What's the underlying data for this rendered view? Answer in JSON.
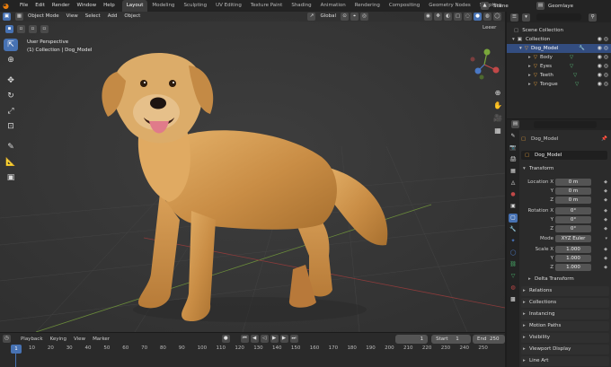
{
  "app_menu": [
    "File",
    "Edit",
    "Render",
    "Window",
    "Help"
  ],
  "workspaces": [
    "Layout",
    "Modeling",
    "Sculpting",
    "UV Editing",
    "Texture Paint",
    "Shading",
    "Animation",
    "Rendering",
    "Compositing",
    "Geometry Nodes",
    "Scripting"
  ],
  "scene_name": "Scene",
  "view_layer": "GeomIaye",
  "viewport": {
    "mode": "Object Mode",
    "menus": [
      "View",
      "Select",
      "Add",
      "Object"
    ],
    "orientation": "Global",
    "perspective_label": "User Perspective",
    "collection_label": "(1) Collection | Dog_Model",
    "right_hint": "Leeer"
  },
  "outliner": {
    "root": "Scene Collection",
    "collection": "Collection",
    "items": [
      {
        "name": "Dog_Model",
        "selected": true
      },
      {
        "name": "Body"
      },
      {
        "name": "Eyes"
      },
      {
        "name": "Teeth"
      },
      {
        "name": "Tongue"
      }
    ]
  },
  "properties": {
    "object_name": "Dog_Model",
    "object_field": "Dog_Model",
    "transform_header": "Transform",
    "location_label": "Location X",
    "location": {
      "x": "0 m",
      "y": "0 m",
      "z": "0 m"
    },
    "rotation_label": "Rotation X",
    "rotation": {
      "x": "0°",
      "y": "0°",
      "z": "0°"
    },
    "mode_label": "Mode",
    "mode_value": "XYZ Euler",
    "scale_label": "Scale X",
    "scale": {
      "x": "1.000",
      "y": "1.000",
      "z": "1.000"
    },
    "axis_y": "Y",
    "axis_z": "Z",
    "sections": [
      "Delta Transform",
      "Relations",
      "Collections",
      "Instancing",
      "Motion Paths",
      "Visibility",
      "Viewport Display",
      "Line Art"
    ]
  },
  "timeline": {
    "menus": [
      "Playback",
      "Keying",
      "View",
      "Marker"
    ],
    "current_frame": "1",
    "start_label": "Start",
    "start": "1",
    "end_label": "End",
    "end": "250",
    "ruler": [
      "1",
      "10",
      "20",
      "30",
      "40",
      "50",
      "60",
      "70",
      "80",
      "90",
      "100",
      "110",
      "120",
      "130",
      "140",
      "150",
      "160",
      "170",
      "180",
      "190",
      "200",
      "210",
      "220",
      "230",
      "240",
      "250"
    ]
  },
  "colors": {
    "accent": "#4772b3",
    "selected_row": "#334d80",
    "brand_orange": "#e87d0d"
  }
}
